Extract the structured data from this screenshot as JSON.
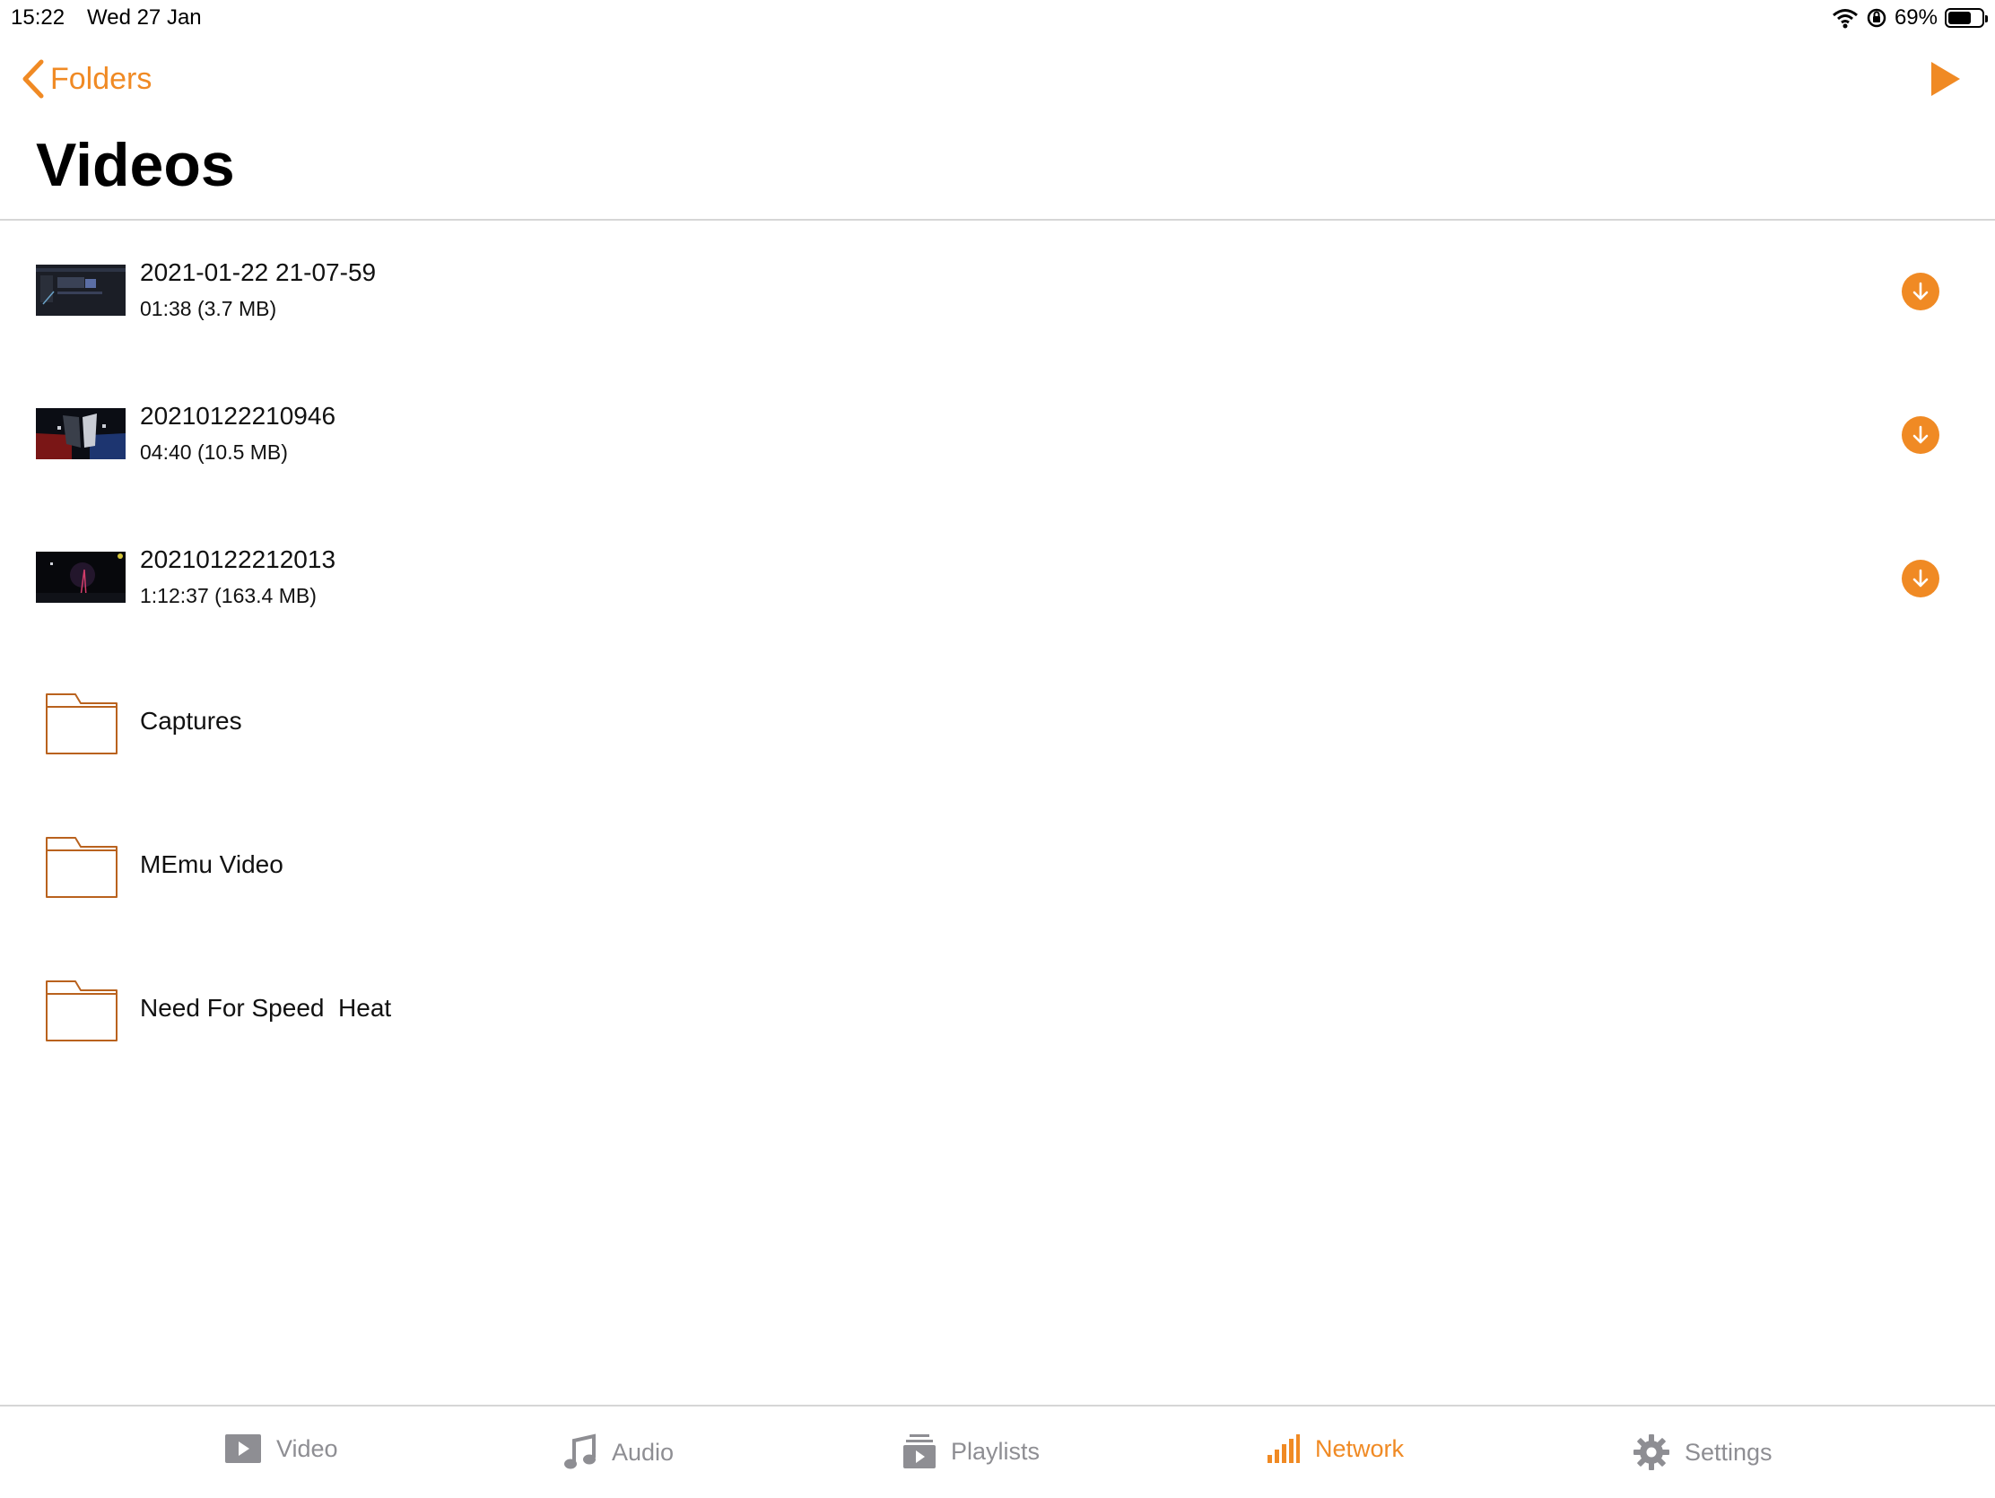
{
  "status_bar": {
    "time": "15:22",
    "date": "Wed 27 Jan",
    "battery_percent": "69%",
    "battery_level": 0.69
  },
  "nav": {
    "back_label": "Folders",
    "title": "Videos"
  },
  "videos": [
    {
      "title": "2021-01-22 21-07-59",
      "meta": "01:38 (3.7 MB)"
    },
    {
      "title": "20210122210946",
      "meta": "04:40 (10.5 MB)"
    },
    {
      "title": "20210122212013",
      "meta": "1:12:37 (163.4 MB)"
    }
  ],
  "folders": [
    {
      "name": "Captures"
    },
    {
      "name": "MEmu Video"
    },
    {
      "name": "Need For Speed  Heat"
    }
  ],
  "tabs": [
    {
      "label": "Video",
      "icon": "video-icon",
      "active": false
    },
    {
      "label": "Audio",
      "icon": "music-note-icon",
      "active": false
    },
    {
      "label": "Playlists",
      "icon": "playlists-icon",
      "active": false
    },
    {
      "label": "Network",
      "icon": "network-bars-icon",
      "active": true
    },
    {
      "label": "Settings",
      "icon": "gear-icon",
      "active": false
    }
  ],
  "colors": {
    "accent": "#f08a24",
    "inactive_tab": "#8e8e93",
    "folder_stroke": "#b9621e"
  }
}
